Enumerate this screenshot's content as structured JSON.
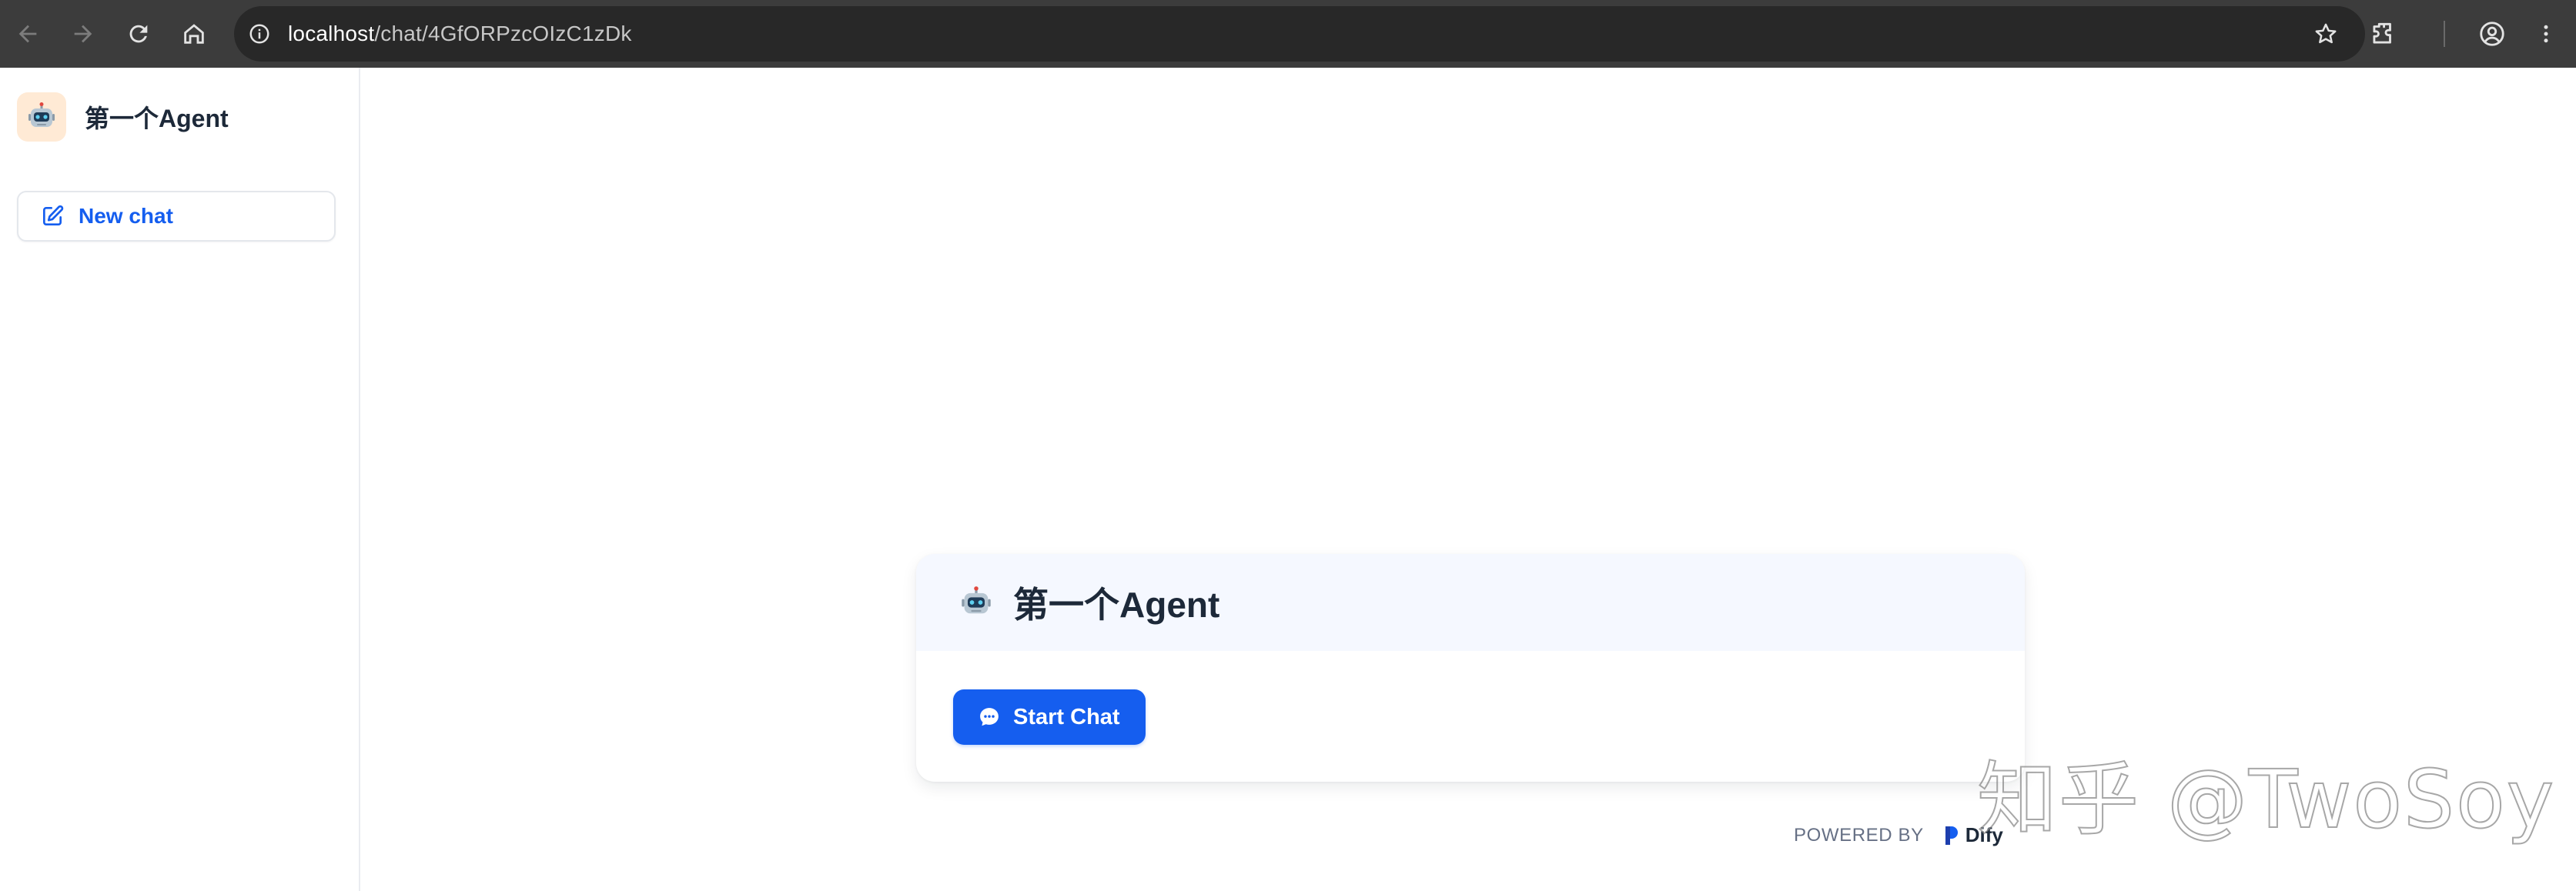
{
  "browser": {
    "url_host": "localhost",
    "url_path": "/chat/4GfORPzcOIzC1zDk"
  },
  "sidebar": {
    "app_name": "第一个Agent",
    "app_icon": "robot-icon",
    "new_chat_label": "New chat"
  },
  "main": {
    "title": "第一个Agent",
    "start_chat_label": "Start Chat",
    "powered_by_label": "POWERED BY",
    "powered_by_brand": "Dify"
  },
  "watermark": {
    "text": "知乎 @TwoSoy"
  },
  "colors": {
    "accent": "#155eef",
    "chrome_bg": "#3c3c3c",
    "card_header_bg": "#f5f8ff",
    "avatar_bg": "#ffead5"
  }
}
